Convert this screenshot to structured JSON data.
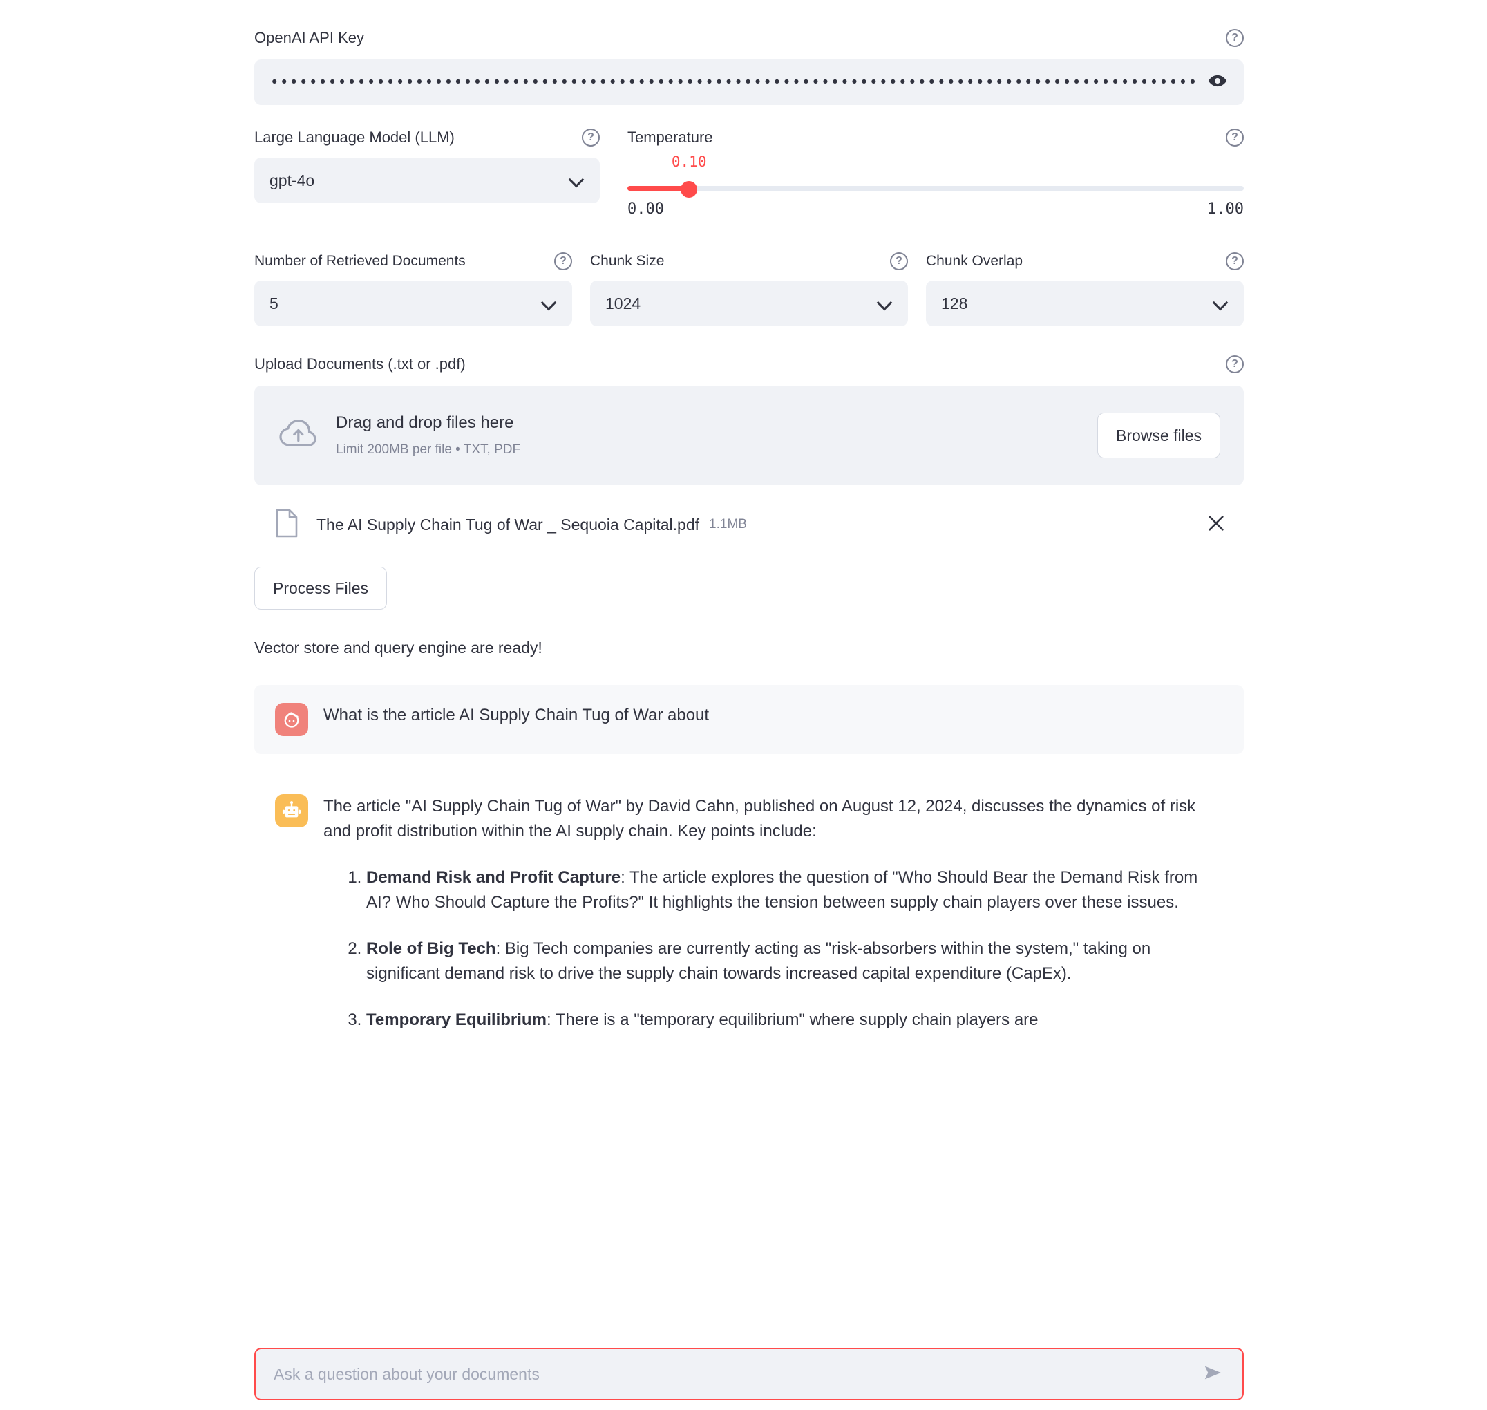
{
  "api_key": {
    "label": "OpenAI API Key",
    "masked_value": "••••••••••••••••••••••••••••••••••••••••••••••••••••••••••••••••••••••••••••••••••••••••••••••••••••••••••••••••••••••••••••••••••••••••••••••",
    "help_glyph": "?",
    "reveal_icon": "eye-icon"
  },
  "llm": {
    "label": "Large Language Model (LLM)",
    "value": "gpt-4o",
    "help_glyph": "?"
  },
  "temperature": {
    "label": "Temperature",
    "value": "0.10",
    "value_number": 0.1,
    "min_label": "0.00",
    "max_label": "1.00",
    "min": 0.0,
    "max": 1.0,
    "accent_color": "#ff4b4b",
    "help_glyph": "?"
  },
  "retrieved_docs": {
    "label": "Number of Retrieved Documents",
    "value": "5",
    "help_glyph": "?"
  },
  "chunk_size": {
    "label": "Chunk Size",
    "value": "1024",
    "help_glyph": "?"
  },
  "chunk_overlap": {
    "label": "Chunk Overlap",
    "value": "128",
    "help_glyph": "?"
  },
  "upload": {
    "label": "Upload Documents (.txt or .pdf)",
    "help_glyph": "?",
    "dropzone_title": "Drag and drop files here",
    "dropzone_limit": "Limit 200MB per file • TXT, PDF",
    "browse_label": "Browse files"
  },
  "uploaded_file": {
    "name": "The AI Supply Chain Tug of War _ Sequoia Capital.pdf",
    "size": "1.1MB",
    "remove_glyph": "✕"
  },
  "actions": {
    "process_files_label": "Process Files",
    "status": "Vector store and query engine are ready!"
  },
  "chat": {
    "user_message": "What is the article AI Supply Chain Tug of War about",
    "assistant_intro": "The article \"AI Supply Chain Tug of War\" by David Cahn, published on August 12, 2024, discusses the dynamics of risk and profit distribution within the AI supply chain. Key points include:",
    "assistant_points": [
      {
        "title": "Demand Risk and Profit Capture",
        "body": ": The article explores the question of \"Who Should Bear the Demand Risk from AI? Who Should Capture the Profits?\" It highlights the tension between supply chain players over these issues."
      },
      {
        "title": "Role of Big Tech",
        "body": ": Big Tech companies are currently acting as \"risk-absorbers within the system,\" taking on significant demand risk to drive the supply chain towards increased capital expenditure (CapEx)."
      },
      {
        "title": "Temporary Equilibrium",
        "body": ": There is a \"temporary equilibrium\" where supply chain players are"
      }
    ],
    "input_placeholder": "Ask a question about your documents",
    "input_value": "",
    "send_icon": "send-icon",
    "user_avatar_color": "#f0827b",
    "bot_avatar_color": "#fabd57"
  }
}
